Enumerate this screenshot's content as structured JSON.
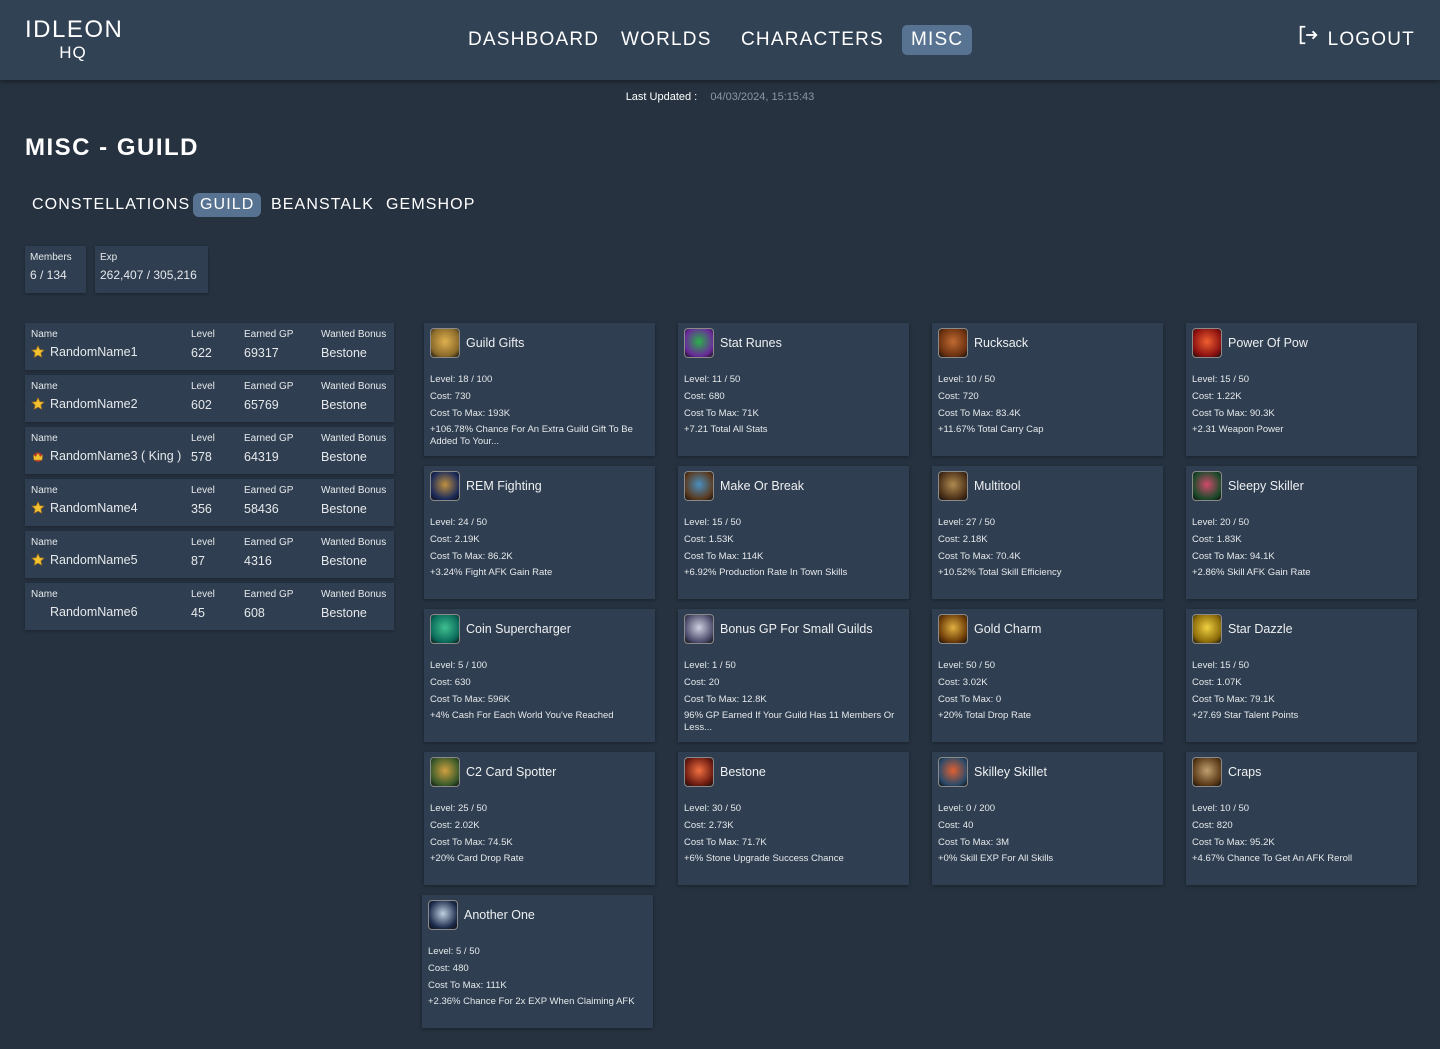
{
  "app": {
    "logo_line1": "IDLEON",
    "logo_line2": "HQ"
  },
  "nav": {
    "items": [
      {
        "label": "DASHBOARD",
        "active": false
      },
      {
        "label": "WORLDS",
        "active": false
      },
      {
        "label": "CHARACTERS",
        "active": false
      },
      {
        "label": "MISC",
        "active": true
      }
    ],
    "logout_label": "LOGOUT",
    "logout_icon": "logout-icon"
  },
  "last_updated": {
    "label": "Last Updated :",
    "value": "04/03/2024, 15:15:43"
  },
  "page_title": "MISC - GUILD",
  "subtabs": [
    {
      "label": "CONSTELLATIONS",
      "active": false
    },
    {
      "label": "GUILD",
      "active": true
    },
    {
      "label": "BEANSTALK",
      "active": false
    },
    {
      "label": "GEMSHOP",
      "active": false
    }
  ],
  "stats": {
    "members": {
      "label": "Members",
      "value": "6 / 134"
    },
    "exp": {
      "label": "Exp",
      "value": "262,407 / 305,216"
    }
  },
  "member_headers": {
    "name": "Name",
    "level": "Level",
    "gp": "Earned GP",
    "bonus": "Wanted Bonus"
  },
  "members": [
    {
      "name": "RandomName1",
      "rank_icon": "star-icon",
      "level": "622",
      "gp": "69317",
      "bonus": "Bestone"
    },
    {
      "name": "RandomName2",
      "rank_icon": "star-icon",
      "level": "602",
      "gp": "65769",
      "bonus": "Bestone"
    },
    {
      "name": "RandomName3 ( King )",
      "rank_icon": "crown-icon",
      "level": "578",
      "gp": "64319",
      "bonus": "Bestone"
    },
    {
      "name": "RandomName4",
      "rank_icon": "star-icon",
      "level": "356",
      "gp": "58436",
      "bonus": "Bestone"
    },
    {
      "name": "RandomName5",
      "rank_icon": "star-icon",
      "level": "87",
      "gp": "4316",
      "bonus": "Bestone"
    },
    {
      "name": "RandomName6",
      "rank_icon": "",
      "level": "45",
      "gp": "608",
      "bonus": "Bestone"
    }
  ],
  "bonuses": [
    {
      "name": "Guild Gifts",
      "icon": "gift-icon",
      "colors": [
        "#8a6a2a",
        "#e0b050"
      ],
      "level": "Level: 18 / 100",
      "cost": "Cost: 730",
      "cost_to_max": "Cost To Max: 193K",
      "desc": "+106.78% Chance For An Extra Guild Gift To Be Added To Your..."
    },
    {
      "name": "Stat Runes",
      "icon": "runes-icon",
      "colors": [
        "#6a2a9a",
        "#2ab04a"
      ],
      "level": "Level: 11 / 50",
      "cost": "Cost: 680",
      "cost_to_max": "Cost To Max: 71K",
      "desc": "+7.21 Total All Stats"
    },
    {
      "name": "Rucksack",
      "icon": "rucksack-icon",
      "colors": [
        "#6a3010",
        "#c06a30"
      ],
      "level": "Level: 10 / 50",
      "cost": "Cost: 720",
      "cost_to_max": "Cost To Max: 83.4K",
      "desc": "+11.67% Total Carry Cap"
    },
    {
      "name": "Power Of Pow",
      "icon": "power-icon",
      "colors": [
        "#8a1010",
        "#f06030"
      ],
      "level": "Level: 15 / 50",
      "cost": "Cost: 1.22K",
      "cost_to_max": "Cost To Max: 90.3K",
      "desc": "+2.31 Weapon Power"
    },
    {
      "name": "REM Fighting",
      "icon": "rem-fighting-icon",
      "colors": [
        "#1a2a5a",
        "#c09040"
      ],
      "level": "Level: 24 / 50",
      "cost": "Cost: 2.19K",
      "cost_to_max": "Cost To Max: 86.2K",
      "desc": "+3.24% Fight AFK Gain Rate"
    },
    {
      "name": "Make Or Break",
      "icon": "make-or-break-icon",
      "colors": [
        "#5a3a20",
        "#4a90c0"
      ],
      "level": "Level: 15 / 50",
      "cost": "Cost: 1.53K",
      "cost_to_max": "Cost To Max: 114K",
      "desc": "+6.92% Production Rate In Town Skills"
    },
    {
      "name": "Multitool",
      "icon": "multitool-icon",
      "colors": [
        "#4a3018",
        "#b08a50"
      ],
      "level": "Level: 27 / 50",
      "cost": "Cost: 2.18K",
      "cost_to_max": "Cost To Max: 70.4K",
      "desc": "+10.52% Total Skill Efficiency"
    },
    {
      "name": "Sleepy Skiller",
      "icon": "sleepy-skiller-icon",
      "colors": [
        "#1a4a2a",
        "#d04a6a"
      ],
      "level": "Level: 20 / 50",
      "cost": "Cost: 1.83K",
      "cost_to_max": "Cost To Max: 94.1K",
      "desc": "+2.86% Skill AFK Gain Rate"
    },
    {
      "name": "Coin Supercharger",
      "icon": "coin-supercharger-icon",
      "colors": [
        "#0a6a5a",
        "#40c090"
      ],
      "level": "Level: 5 / 100",
      "cost": "Cost: 630",
      "cost_to_max": "Cost To Max: 596K",
      "desc": "+4% Cash For Each World You've Reached"
    },
    {
      "name": "Bonus GP For Small Guilds",
      "icon": "bonus-gp-icon",
      "colors": [
        "#4a4a6a",
        "#d0d0e0"
      ],
      "level": "Level: 1 / 50",
      "cost": "Cost: 20",
      "cost_to_max": "Cost To Max: 12.8K",
      "desc": "96% GP Earned If Your Guild Has 11 Members Or Less..."
    },
    {
      "name": "Gold Charm",
      "icon": "gold-charm-icon",
      "colors": [
        "#6a3a08",
        "#e0b040"
      ],
      "level": "Level: 50 / 50",
      "cost": "Cost: 3.02K",
      "cost_to_max": "Cost To Max: 0",
      "desc": "+20% Total Drop Rate"
    },
    {
      "name": "Star Dazzle",
      "icon": "star-dazzle-icon",
      "colors": [
        "#8a6a08",
        "#f0d040"
      ],
      "level": "Level: 15 / 50",
      "cost": "Cost: 1.07K",
      "cost_to_max": "Cost To Max: 79.1K",
      "desc": "+27.69 Star Talent Points"
    },
    {
      "name": "C2 Card Spotter",
      "icon": "card-spotter-icon",
      "colors": [
        "#3a5a2a",
        "#d0a040"
      ],
      "level": "Level: 25 / 50",
      "cost": "Cost: 2.02K",
      "cost_to_max": "Cost To Max: 74.5K",
      "desc": "+20% Card Drop Rate"
    },
    {
      "name": "Bestone",
      "icon": "bestone-icon",
      "colors": [
        "#6a1a10",
        "#f07040"
      ],
      "level": "Level: 30 / 50",
      "cost": "Cost: 2.73K",
      "cost_to_max": "Cost To Max: 71.7K",
      "desc": "+6% Stone Upgrade Success Chance"
    },
    {
      "name": "Skilley Skillet",
      "icon": "skilley-skillet-icon",
      "colors": [
        "#2a4a6a",
        "#e06030"
      ],
      "level": "Level: 0 / 200",
      "cost": "Cost: 40",
      "cost_to_max": "Cost To Max: 3M",
      "desc": "+0% Skill EXP For All Skills"
    },
    {
      "name": "Craps",
      "icon": "craps-icon",
      "colors": [
        "#5a3a18",
        "#c0a070"
      ],
      "level": "Level: 10 / 50",
      "cost": "Cost: 820",
      "cost_to_max": "Cost To Max: 95.2K",
      "desc": "+4.67% Chance To Get An AFK Reroll"
    },
    {
      "name": "Another One",
      "icon": "another-one-icon",
      "colors": [
        "#1a2a4a",
        "#c0d0e0"
      ],
      "level": "Level: 5 / 50",
      "cost": "Cost: 480",
      "cost_to_max": "Cost To Max: 111K",
      "desc": "+2.36% Chance For 2x EXP When Claiming AFK"
    }
  ]
}
